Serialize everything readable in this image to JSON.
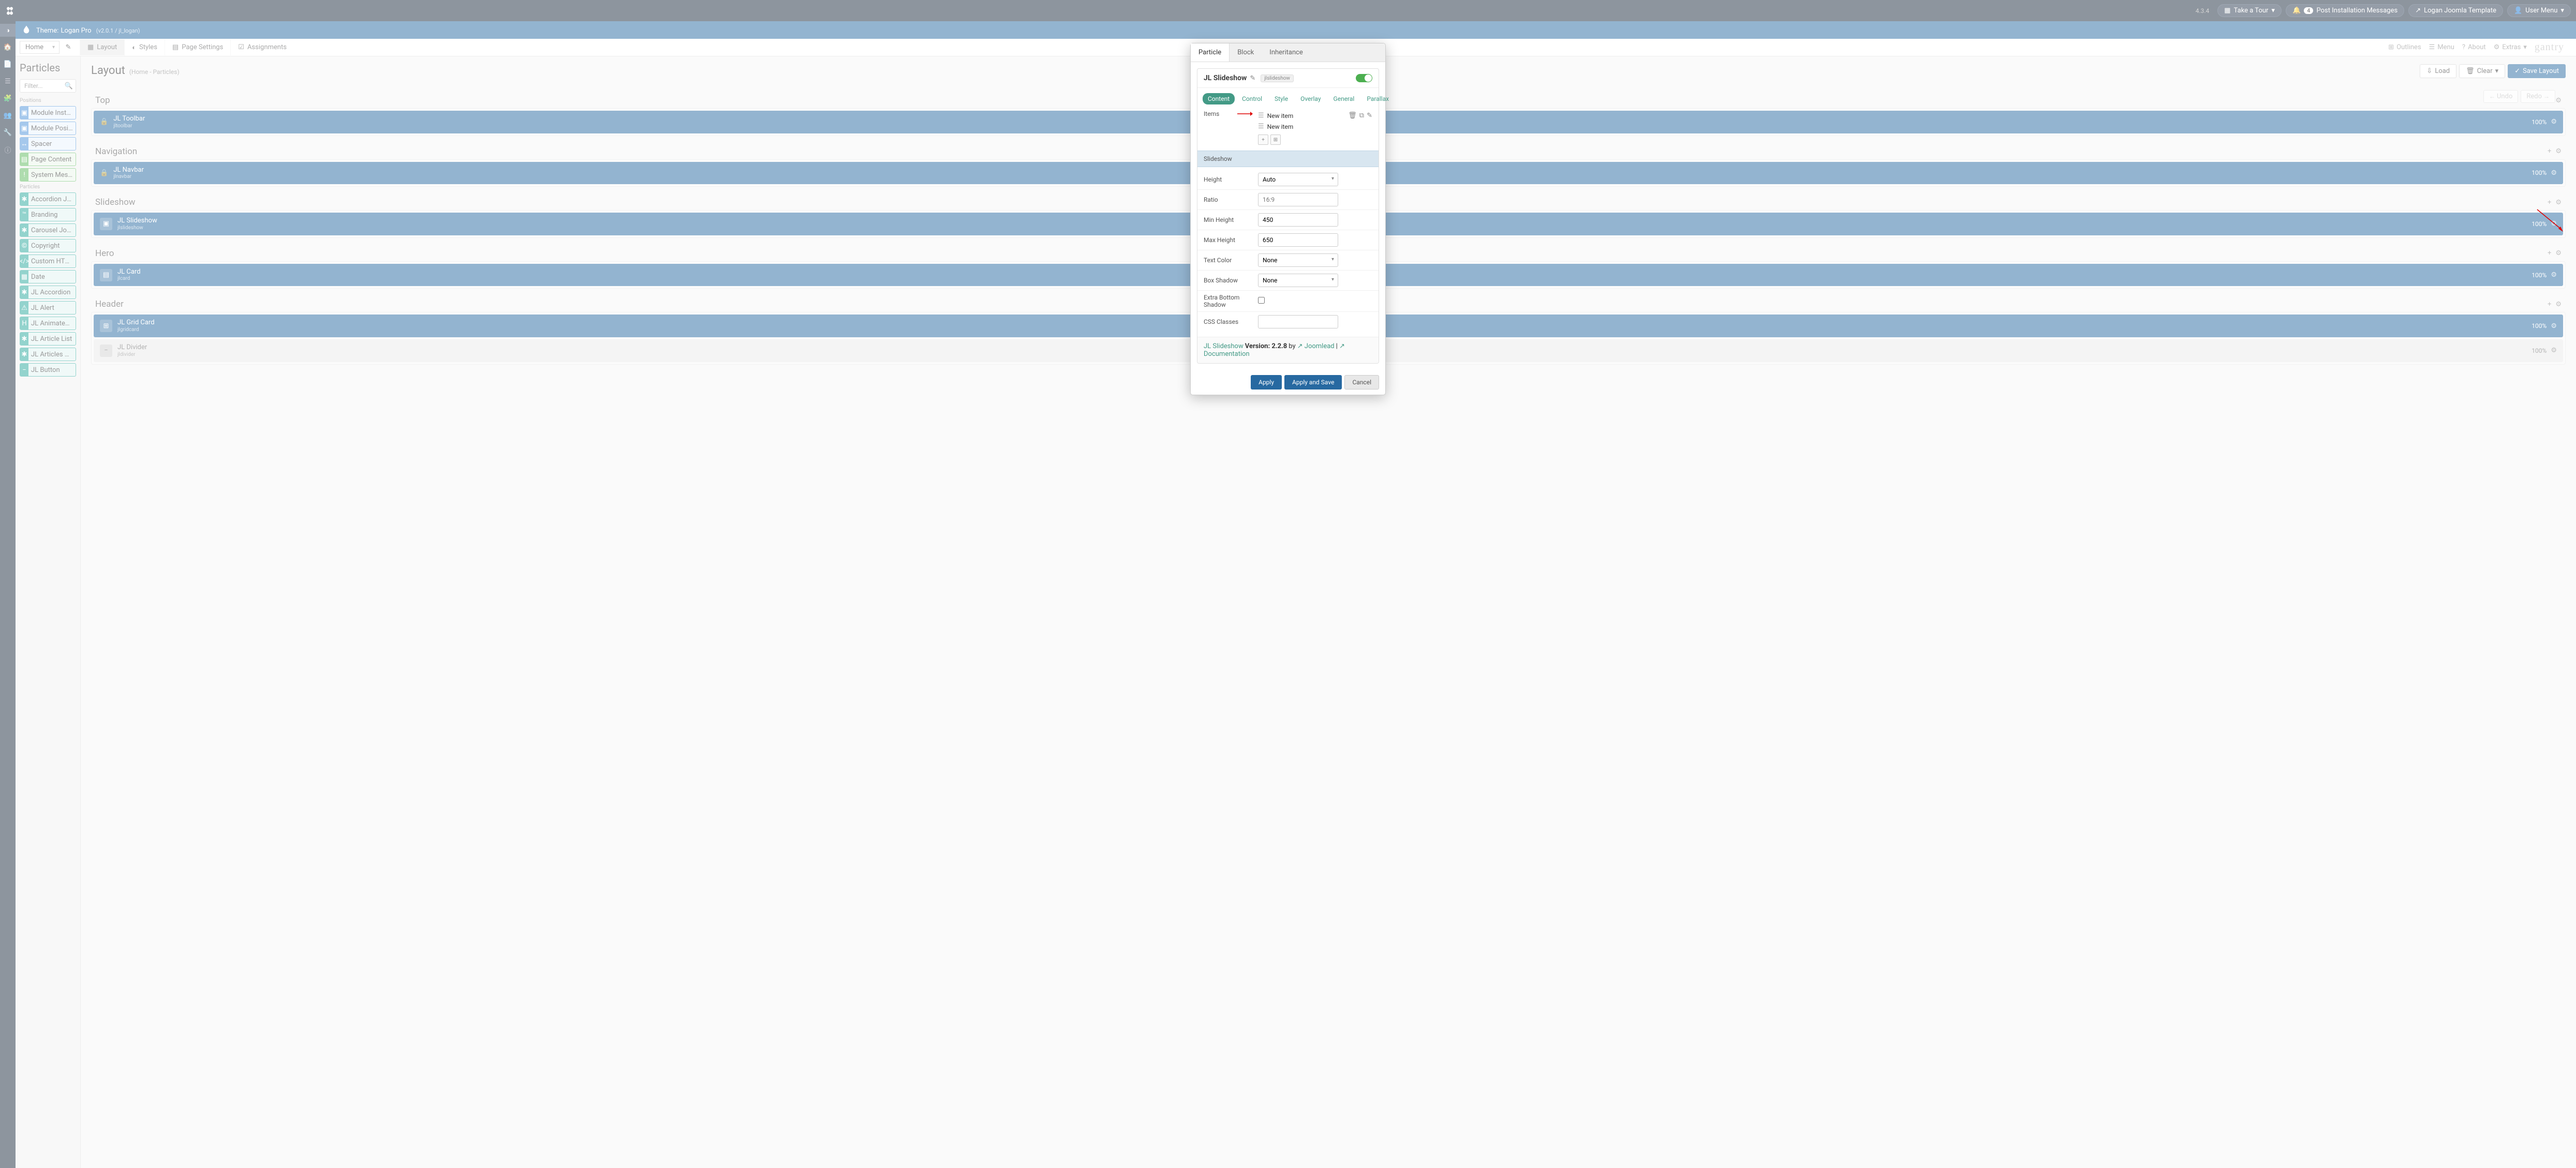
{
  "topbar": {
    "version": "4.3.4",
    "tour": "Take a Tour",
    "notif_count": "4",
    "post_install": "Post Installation Messages",
    "template": "Logan Joomla Template",
    "user_menu": "User Menu"
  },
  "titlebar": {
    "prefix": "Theme:",
    "name": "Logan Pro",
    "sub": "(v2.0.1 / jl_logan)"
  },
  "toolbar": {
    "home": "Home",
    "layout": "Layout",
    "styles": "Styles",
    "page_settings": "Page Settings",
    "assignments": "Assignments",
    "outlines": "Outlines",
    "menu": "Menu",
    "about": "About",
    "extras": "Extras",
    "gantry": "gantry"
  },
  "sidebar": {
    "title": "Particles",
    "filter_placeholder": "Filter...",
    "positions_label": "Positions",
    "particles_label": "Particles",
    "items": {
      "module_instance": "Module Instance",
      "module_position": "Module Position",
      "spacer": "Spacer",
      "page_content": "Page Content",
      "system_messages": "System Messages",
      "accordion_joomla": "Accordion Joomla",
      "branding": "Branding",
      "carousel_joomla": "Carousel Joomla",
      "copyright": "Copyright",
      "custom_html": "Custom HTML",
      "date": "Date",
      "jl_accordion": "JL Accordion",
      "jl_alert": "JL Alert",
      "jl_animated_text": "JL Animated Text",
      "jl_article_list": "JL Article List",
      "jl_articles_gallery": "JL Articles Gallery",
      "jl_button": "JL Button"
    }
  },
  "main": {
    "title": "Layout",
    "sub": "(Home - Particles)",
    "load": "Load",
    "clear": "Clear",
    "save_layout": "Save Layout",
    "undo": "Undo",
    "redo": "Redo"
  },
  "sections": {
    "top": {
      "title": "Top",
      "block": "JL Toolbar",
      "blocksub": "jltoolbar",
      "pct": "100%"
    },
    "navigation": {
      "title": "Navigation",
      "block": "JL Navbar",
      "blocksub": "jlnavbar",
      "pct": "100%"
    },
    "slideshow": {
      "title": "Slideshow",
      "block": "JL Slideshow",
      "blocksub": "jlslideshow",
      "pct": "100%"
    },
    "hero": {
      "title": "Hero",
      "block": "JL Card",
      "blocksub": "jlcard",
      "pct": "100%"
    },
    "header": {
      "title": "Header",
      "block1": "JL Grid Card",
      "block1sub": "jlgridcard",
      "pct1": "100%",
      "block2": "JL Divider",
      "block2sub": "jldivider",
      "pct2": "100%"
    }
  },
  "modal": {
    "tabs": {
      "particle": "Particle",
      "block": "Block",
      "inheritance": "Inheritance"
    },
    "particle_title": "JL Slideshow",
    "particle_badge": "jlslideshow",
    "subtabs": {
      "content": "Content",
      "control": "Control",
      "style": "Style",
      "overlay": "Overlay",
      "general": "General",
      "parallax": "Parallax"
    },
    "items_label": "Items",
    "new_item": "New item",
    "slideshow_section": "Slideshow",
    "fields": {
      "height": "Height",
      "height_val": "Auto",
      "ratio": "Ratio",
      "ratio_ph": "16:9",
      "min_height": "Min Height",
      "min_height_val": "450",
      "max_height": "Max Height",
      "max_height_val": "650",
      "text_color": "Text Color",
      "text_color_val": "None",
      "box_shadow": "Box Shadow",
      "box_shadow_val": "None",
      "extra_shadow": "Extra Bottom Shadow",
      "css_classes": "CSS Classes"
    },
    "footer": {
      "name": "JL Slideshow",
      "version_label": "Version: 2.2.8",
      "by": "by",
      "joomlead": "Joomlead",
      "sep": " | ",
      "documentation": "Documentation"
    },
    "actions": {
      "apply": "Apply",
      "apply_save": "Apply and Save",
      "cancel": "Cancel"
    }
  }
}
